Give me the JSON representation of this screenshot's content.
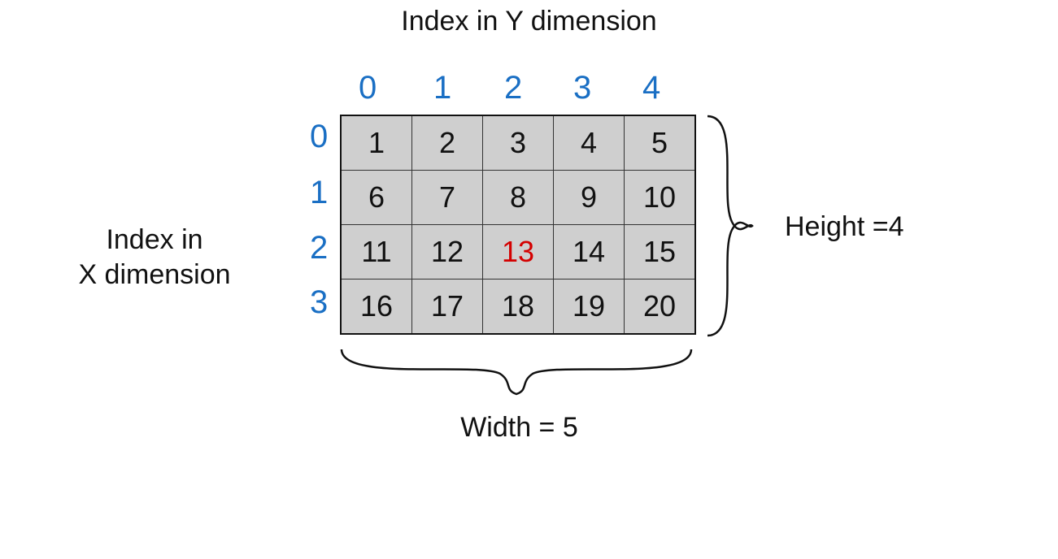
{
  "labels": {
    "yTitle": "Index in Y dimension",
    "xTitle": "Index in\nX dimension",
    "height": "Height =4",
    "width": "Width = 5"
  },
  "yIndices": [
    "0",
    "1",
    "2",
    "3",
    "4"
  ],
  "xIndices": [
    "0",
    "1",
    "2",
    "3"
  ],
  "gridRows": [
    [
      "1",
      "2",
      "3",
      "4",
      "5"
    ],
    [
      "6",
      "7",
      "8",
      "9",
      "10"
    ],
    [
      "11",
      "12",
      "13",
      "14",
      "15"
    ],
    [
      "16",
      "17",
      "18",
      "19",
      "20"
    ]
  ],
  "highlight": {
    "row": 2,
    "col": 2
  }
}
